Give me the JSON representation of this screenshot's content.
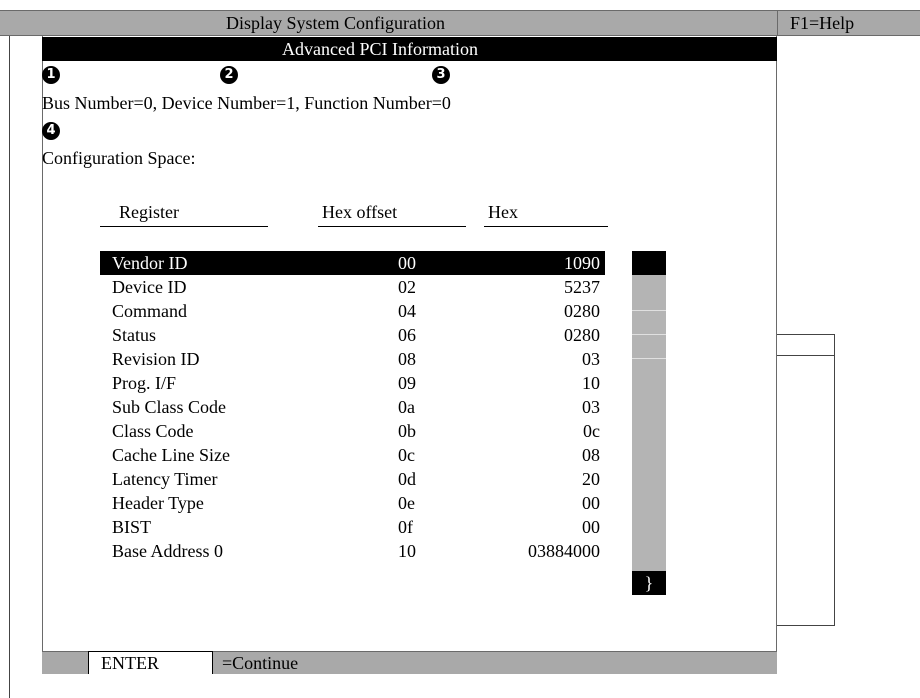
{
  "header": {
    "title": "Display System Configuration",
    "help": "F1=Help"
  },
  "panel": {
    "title": "Advanced PCI Information",
    "callouts": [
      "1",
      "2",
      "3",
      "4"
    ],
    "bus_line": "Bus Number=0,  Device Number=1,  Function Number=0",
    "config_label": "Configuration Space:"
  },
  "table": {
    "columns": [
      "Register",
      "Hex offset",
      "Hex"
    ],
    "rows": [
      {
        "name": "Vendor  ID",
        "offset": "00",
        "hex": "1090"
      },
      {
        "name": "Device  ID",
        "offset": "02",
        "hex": "5237"
      },
      {
        "name": "Command",
        "offset": "04",
        "hex": "0280"
      },
      {
        "name": "Status",
        "offset": "06",
        "hex": "0280"
      },
      {
        "name": "Revision  ID",
        "offset": "08",
        "hex": "03"
      },
      {
        "name": "Prog.  I/F",
        "offset": "09",
        "hex": "10"
      },
      {
        "name": "Sub Class Code",
        "offset": "0a",
        "hex": "03"
      },
      {
        "name": "Class Code",
        "offset": "0b",
        "hex": "0c"
      },
      {
        "name": "Cache Line Size",
        "offset": "0c",
        "hex": "08"
      },
      {
        "name": "Latency Timer",
        "offset": "0d",
        "hex": "20"
      },
      {
        "name": "Header Type",
        "offset": "0e",
        "hex": "00"
      },
      {
        "name": "BIST",
        "offset": "0f",
        "hex": "00"
      },
      {
        "name": "Base Address 0",
        "offset": "10",
        "hex": "03884000"
      }
    ],
    "selected_index": 0
  },
  "scrollbar": {
    "down_glyph": "}"
  },
  "footer": {
    "key": "ENTER",
    "description": "=Continue"
  }
}
